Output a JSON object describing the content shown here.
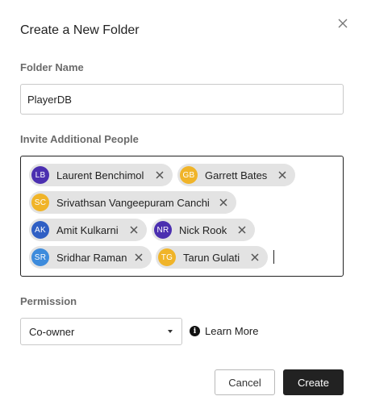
{
  "dialog": {
    "title": "Create a New Folder"
  },
  "folder_name": {
    "label": "Folder Name",
    "value": "PlayerDB"
  },
  "invite": {
    "label": "Invite Additional People",
    "people": [
      {
        "initials": "LB",
        "name": "Laurent Benchimol",
        "color": "#4b2fb0"
      },
      {
        "initials": "GB",
        "name": "Garrett Bates",
        "color": "#f0b429"
      },
      {
        "initials": "SC",
        "name": "Srivathsan Vangeepuram Canchi",
        "color": "#f0b429"
      },
      {
        "initials": "AK",
        "name": "Amit Kulkarni",
        "color": "#2f5fc4"
      },
      {
        "initials": "NR",
        "name": "Nick Rook",
        "color": "#4b2fb0"
      },
      {
        "initials": "SR",
        "name": "Sridhar Raman",
        "color": "#3d8bdc"
      },
      {
        "initials": "TG",
        "name": "Tarun Gulati",
        "color": "#f0b429"
      }
    ]
  },
  "permission": {
    "label": "Permission",
    "selected": "Co-owner",
    "learn_more": "Learn More"
  },
  "actions": {
    "cancel_label": "Cancel",
    "create_label": "Create"
  },
  "icons": {
    "close": "close-icon",
    "remove": "remove-chip-icon",
    "dropdown": "chevron-down-icon",
    "info": "info-icon"
  }
}
